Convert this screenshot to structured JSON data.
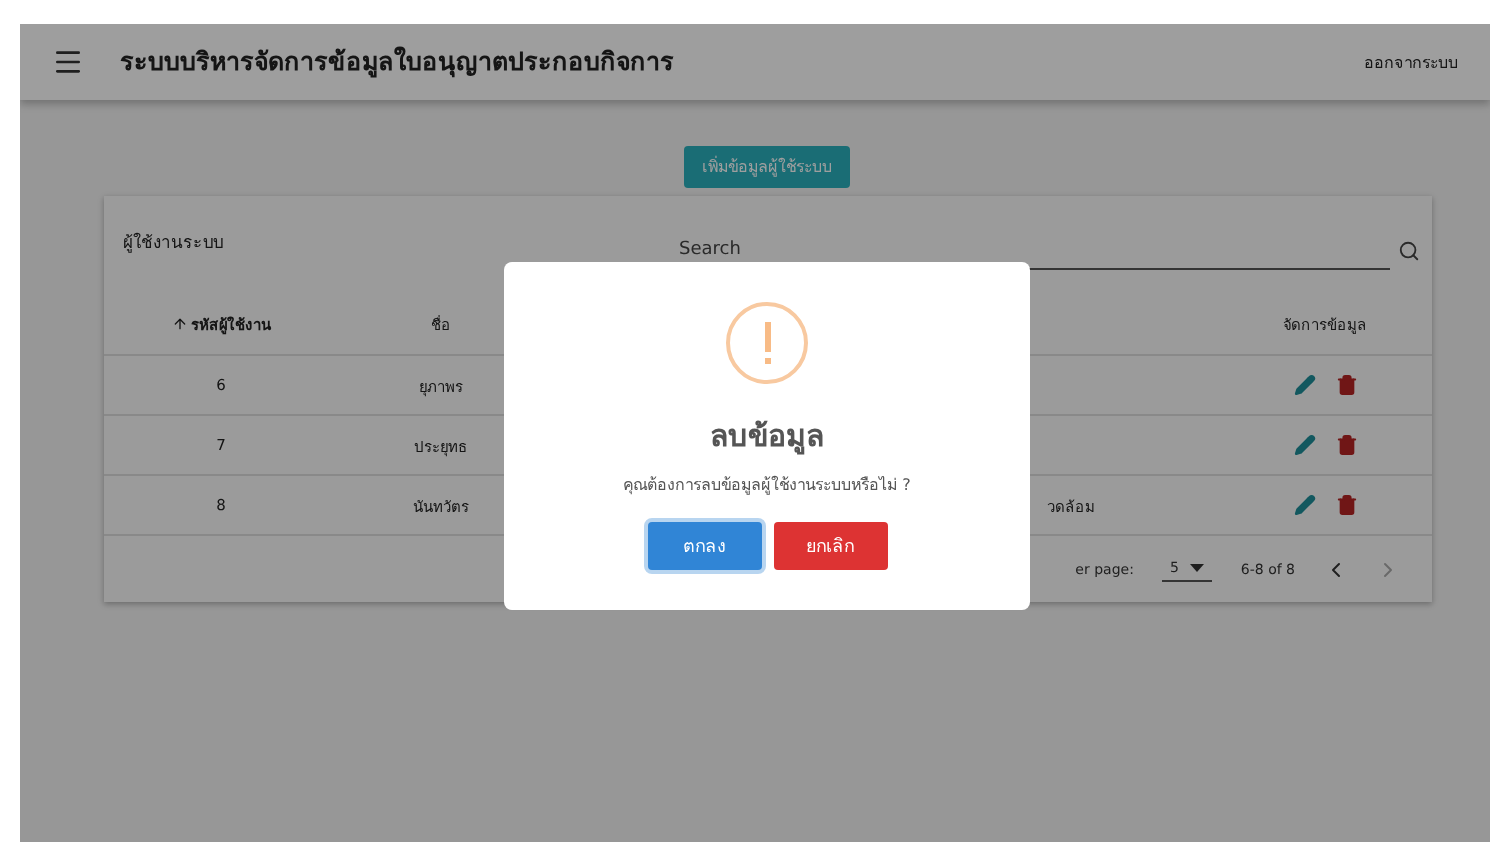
{
  "app_bar": {
    "title": "ระบบบริหารจัดการข้อมูลใบอนุญาตประกอบกิจการ",
    "logout": "ออกจากระบบ"
  },
  "add_button": "เพิ่มข้อมูลผู้ใช้ระบบ",
  "users_card": {
    "title": "ผู้ใช้งานระบบ",
    "search": {
      "placeholder": "Search"
    },
    "columns": [
      {
        "label": "รหัสผู้ใช้งาน",
        "sorted": true
      },
      {
        "label": "ชื่อ",
        "sorted": false
      },
      {
        "label": "จัดการข้อมูล",
        "sorted": false
      }
    ],
    "rows": [
      {
        "id": "6",
        "name": "ยุภาพร"
      },
      {
        "id": "7",
        "name": "ประยุทธ"
      },
      {
        "id": "8",
        "name": "นันทวัตร",
        "column_3": "วดล้อม"
      }
    ],
    "pagination": {
      "rows_per_page_label": "er page:",
      "rows_per_page": "5",
      "range": "6-8 of 8"
    }
  },
  "dialog": {
    "title": "ลบข้อมูล",
    "message": "คุณต้องการลบข้อมูลผู้ใช้งานระบบหรือไม่ ?",
    "confirm": "ตกลง",
    "cancel": "ยกเลิก"
  }
}
